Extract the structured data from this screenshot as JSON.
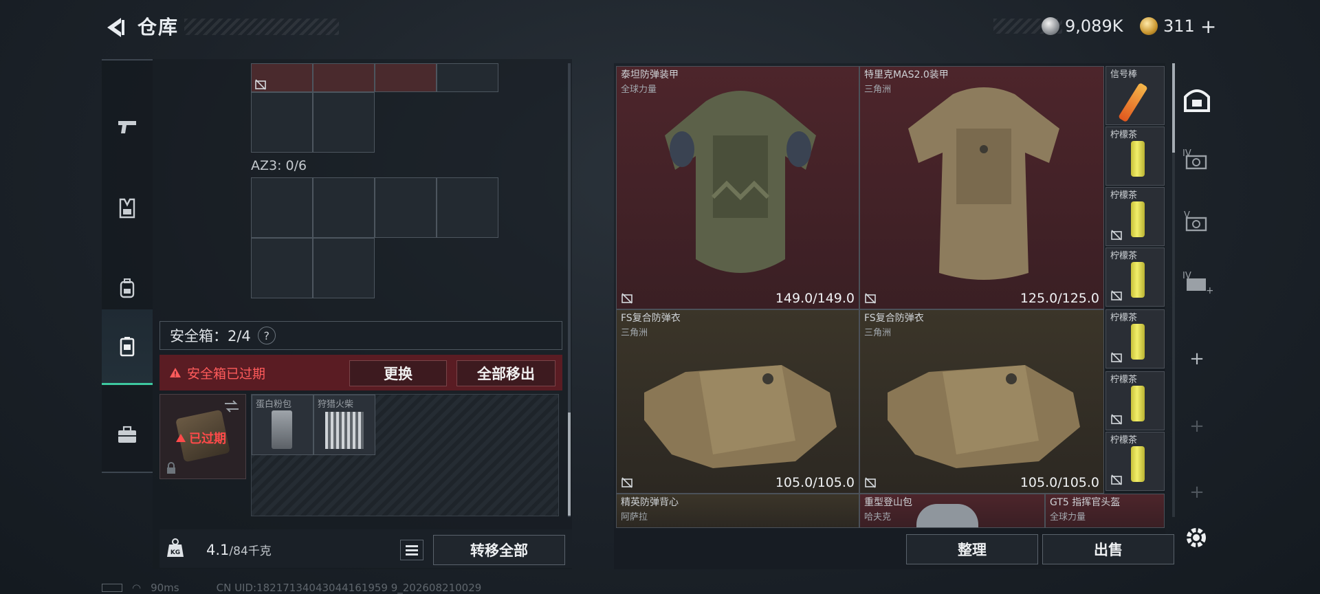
{
  "header": {
    "title": "仓库",
    "currency": [
      {
        "icon": "silver-coin-icon",
        "value": "9,089K"
      },
      {
        "icon": "gold-coin-icon",
        "value": "311"
      }
    ],
    "add_symbol": "+"
  },
  "left_nav": {
    "items": [
      {
        "name": "weapon-tab",
        "icon": "pistol-icon"
      },
      {
        "name": "armor-tab",
        "icon": "vest-icon"
      },
      {
        "name": "backpack-tab",
        "icon": "backpack-icon"
      },
      {
        "name": "safebox-tab",
        "icon": "safebox-icon",
        "active": true
      },
      {
        "name": "toolbox-tab",
        "icon": "briefcase-icon"
      }
    ]
  },
  "left_panel": {
    "az3_label": "AZ3: 0/6",
    "safebox_label": "安全箱：2/4",
    "help": "?",
    "expired_warning": "安全箱已过期",
    "replace_button": "更换",
    "remove_all_button": "全部移出",
    "case_status": "已过期",
    "case_slots": [
      {
        "label": "蛋白粉包"
      },
      {
        "label": "狩猎火柴"
      }
    ],
    "weight_value": "4.1",
    "weight_max": "/84千克",
    "kg_label": "KG",
    "transfer_all_button": "转移全部"
  },
  "right_panel": {
    "items": [
      {
        "name": "泰坦防弹装甲",
        "sub": "全球力量",
        "durability": "149.0/149.0",
        "color": "red"
      },
      {
        "name": "特里克MAS2.0装甲",
        "sub": "三角洲",
        "durability": "125.0/125.0",
        "color": "red"
      },
      {
        "name": "FS复合防弹衣",
        "sub": "三角洲",
        "durability": "105.0/105.0",
        "color": "brown"
      },
      {
        "name": "FS复合防弹衣",
        "sub": "三角洲",
        "durability": "105.0/105.0",
        "color": "brown"
      }
    ],
    "small_items": [
      {
        "name": "信号棒"
      },
      {
        "name": "柠檬茶"
      },
      {
        "name": "柠檬茶"
      },
      {
        "name": "柠檬茶"
      },
      {
        "name": "柠檬茶"
      },
      {
        "name": "柠檬茶"
      },
      {
        "name": "柠檬茶"
      }
    ],
    "bottom_row": [
      {
        "name": "精英防弹背心",
        "sub": "阿萨拉"
      },
      {
        "name": "重型登山包",
        "sub": "哈夫克"
      },
      {
        "name": "GT5 指挥官头盔",
        "sub": "全球力量"
      }
    ],
    "sort_button": "整理",
    "sell_button": "出售"
  },
  "right_rail": {
    "items": [
      {
        "name": "warehouse-tab-1",
        "icon": "warehouse-icon"
      },
      {
        "name": "warehouse-tab-4",
        "label": "IV"
      },
      {
        "name": "warehouse-tab-5",
        "label": "V"
      },
      {
        "name": "warehouse-tab-6",
        "label": "IV"
      },
      {
        "name": "add-tab-1",
        "label": "+"
      },
      {
        "name": "add-tab-2",
        "label": "+"
      },
      {
        "name": "add-tab-3",
        "label": "+"
      }
    ]
  },
  "status_bar": {
    "ping": "90ms",
    "uid": "CN UID:18217134043044161959 9_202608210029"
  }
}
